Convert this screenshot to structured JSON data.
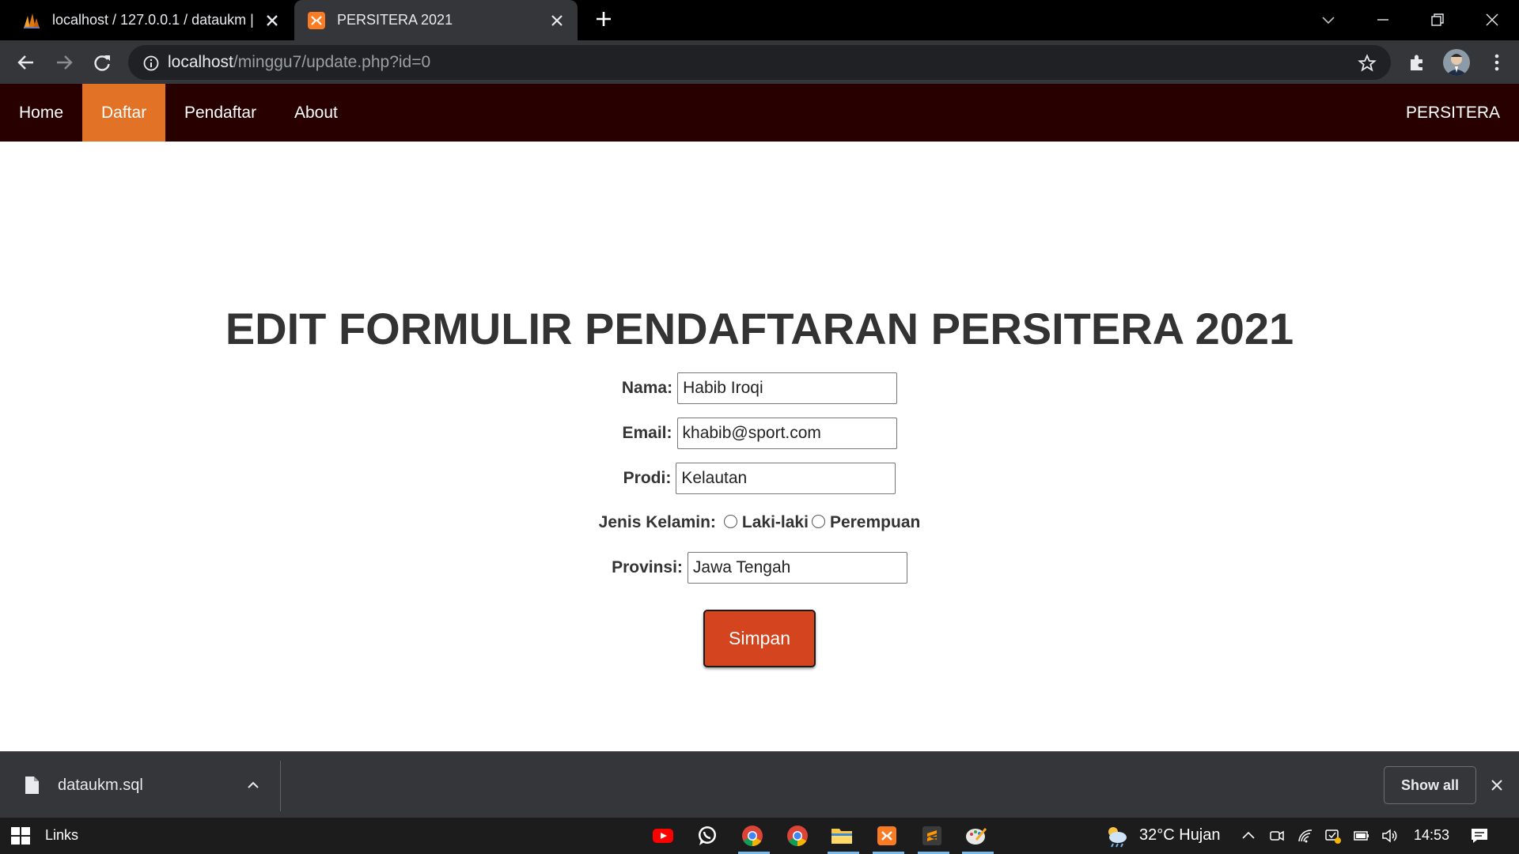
{
  "browser": {
    "tabs": [
      {
        "title": "localhost / 127.0.0.1 / dataukm |",
        "active": false,
        "icon": "phpmyadmin-icon"
      },
      {
        "title": "PERSITERA 2021",
        "active": true,
        "icon": "xampp-icon"
      }
    ],
    "url_host": "localhost",
    "url_path": "/minggu7/update.php?id=0"
  },
  "site": {
    "nav": [
      {
        "label": "Home",
        "active": false
      },
      {
        "label": "Daftar",
        "active": true
      },
      {
        "label": "Pendaftar",
        "active": false
      },
      {
        "label": "About",
        "active": false
      }
    ],
    "brand": "PERSITERA",
    "colors": {
      "navbar": "#290000",
      "active_tab": "#e27225",
      "button": "#d4441f"
    }
  },
  "form": {
    "title": "EDIT FORMULIR PENDAFTARAN PERSITERA 2021",
    "nama_label": "Nama:",
    "nama_value": "Habib Iroqi",
    "email_label": "Email:",
    "email_value": "khabib@sport.com",
    "prodi_label": "Prodi:",
    "prodi_value": "Kelautan",
    "gender_label": "Jenis Kelamin:",
    "gender_options": [
      "Laki-laki",
      "Perempuan"
    ],
    "provinsi_label": "Provinsi:",
    "provinsi_value": "Jawa Tengah",
    "submit_label": "Simpan"
  },
  "downloads": {
    "file": "dataukm.sql",
    "show_all": "Show all"
  },
  "taskbar": {
    "links_label": "Links",
    "weather": "32°C  Hujan",
    "time": "14:53"
  }
}
